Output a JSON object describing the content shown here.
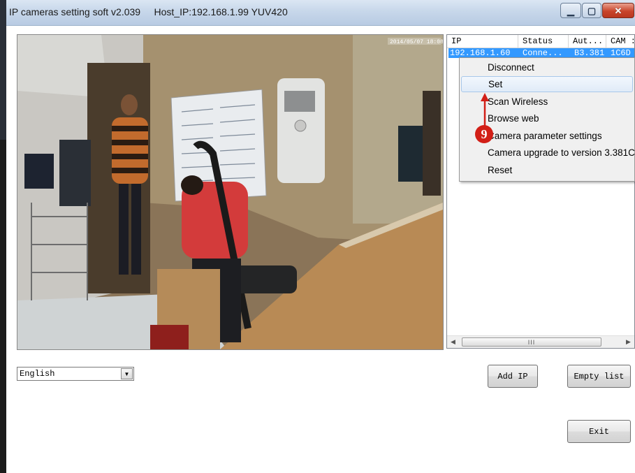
{
  "window": {
    "title": "IP cameras setting soft v2.039     Host_IP:192.168.1.99 YUV420"
  },
  "device_table": {
    "columns": [
      "IP",
      "Status",
      "Aut...",
      "CAM :"
    ],
    "rows": [
      {
        "ip": "192.168.1.60",
        "status": "Conne...",
        "aut": "B3.381",
        "cam": "1C6D"
      }
    ],
    "scroll_thumb_label": "III"
  },
  "context_menu": {
    "items": [
      "Disconnect",
      "Set",
      "Scan Wireless",
      "Browse web",
      "Camera parameter settings",
      "Camera upgrade to version 3.381C",
      "Reset"
    ],
    "highlighted": "Set"
  },
  "annotation": {
    "step": "9",
    "color": "#d21f17"
  },
  "language_select": {
    "value": "English"
  },
  "buttons": {
    "add_ip": "Add IP",
    "empty_list": "Empty list",
    "exit": "Exit"
  },
  "video": {
    "timestamp": "2014/05/07 18:08:40"
  },
  "colors": {
    "selection": "#3399ff",
    "close_button": "#c9452c",
    "annotation": "#d21f17"
  }
}
